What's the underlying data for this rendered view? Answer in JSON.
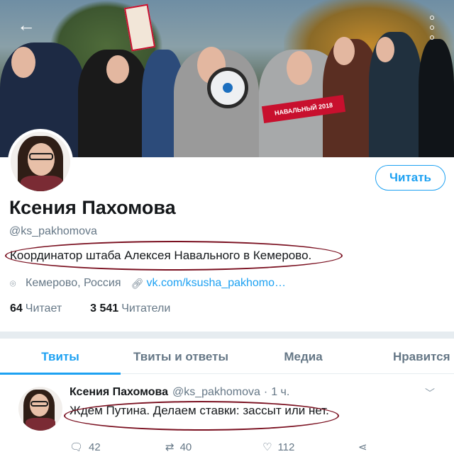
{
  "banner": {
    "sign_text": "НАВАЛЬНЫЙ 2018"
  },
  "nav": {
    "back_icon": "arrow-left-icon",
    "more_icon": "more-vertical-icon"
  },
  "profile": {
    "name": "Ксения Пахомова",
    "handle": "@ks_pakhomova",
    "bio": "Координатор штаба Алексея Навального в Кемерово.",
    "location": "Кемерово, Россия",
    "website": "vk.com/ksusha_pakhomo…",
    "following_count": "64",
    "following_label": "Читает",
    "followers_count": "3 541",
    "followers_label": "Читатели",
    "follow_button": "Читать"
  },
  "tabs": [
    {
      "label": "Твиты",
      "active": true
    },
    {
      "label": "Твиты и ответы",
      "active": false
    },
    {
      "label": "Медиа",
      "active": false
    },
    {
      "label": "Нравится",
      "active": false
    }
  ],
  "tweet": {
    "author_name": "Ксения Пахомова",
    "author_handle": "@ks_pakhomova",
    "separator": "·",
    "time": "1 ч.",
    "text": "Ждем Путина. Делаем ставки: зассыт или нет.",
    "replies": "42",
    "retweets": "40",
    "likes": "112"
  },
  "colors": {
    "accent": "#1da1f2",
    "annotation": "#7a1020",
    "secondary_text": "#657786"
  }
}
